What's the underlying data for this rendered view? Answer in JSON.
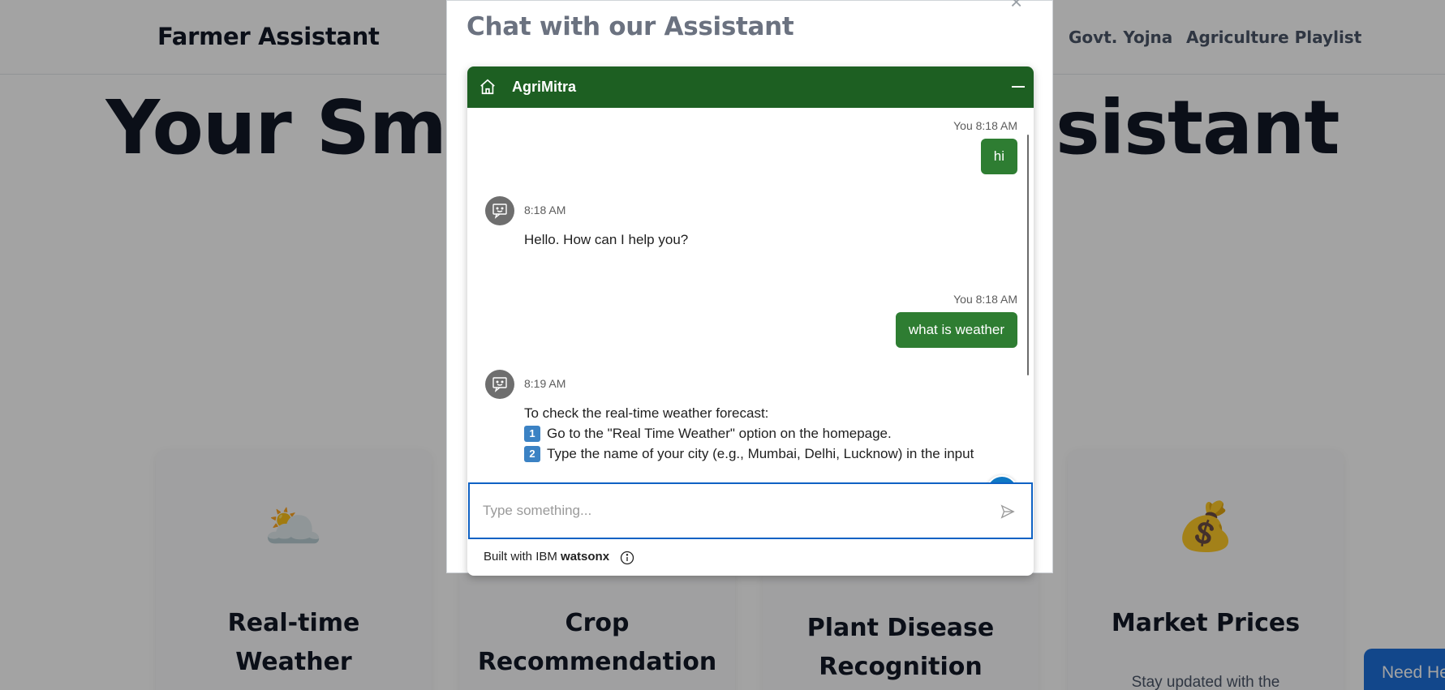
{
  "page": {
    "brand": "Farmer Assistant",
    "nav": [
      "Govt. Yojna",
      "Agriculture Playlist"
    ],
    "hero_title": "Your Smart Farming Assistant",
    "cards": [
      {
        "icon": "🌥️",
        "icon_name": "sun-behind-cloud-icon",
        "title_line1": "Real-time",
        "title_line2": "Weather",
        "desc": ""
      },
      {
        "icon": "",
        "icon_name": "",
        "title_line1": "Crop",
        "title_line2": "Recommendation",
        "desc": ""
      },
      {
        "icon": "",
        "icon_name": "",
        "title_line1": "Plant Disease",
        "title_line2": "Recognition",
        "desc": ""
      },
      {
        "icon": "💰",
        "icon_name": "money-bag-icon",
        "title_line1": "Market Prices",
        "title_line2": "",
        "desc": "Stay updated with the"
      }
    ],
    "need_help": "Need Help"
  },
  "modal": {
    "title": "Chat with our Assistant",
    "close_icon": "×"
  },
  "chat": {
    "assistant_name": "AgriMitra",
    "messages": [
      {
        "from": "user",
        "label": "You 8:18 AM",
        "text": "hi"
      },
      {
        "from": "bot",
        "time": "8:18 AM",
        "text": "Hello. How can I help you?"
      },
      {
        "from": "user",
        "label": "You 8:18 AM",
        "text": "what is weather"
      },
      {
        "from": "bot",
        "time": "8:19 AM",
        "text": "To check the real-time weather forecast:",
        "steps": [
          {
            "num": "1",
            "text": "Go to the \"Real Time Weather\" option on the homepage."
          },
          {
            "num": "2",
            "text": "Type the name of your city (e.g., Mumbai, Delhi, Lucknow) in the input"
          }
        ]
      }
    ],
    "help_fab": "?",
    "input_placeholder": "Type something...",
    "footer_prefix": "Built with IBM ",
    "footer_brand": "watsonx"
  },
  "colors": {
    "header_green": "#1d5f22",
    "user_bubble": "#2e7d32",
    "input_focus": "#0f62c4",
    "help_fab": "#0f78c4"
  }
}
